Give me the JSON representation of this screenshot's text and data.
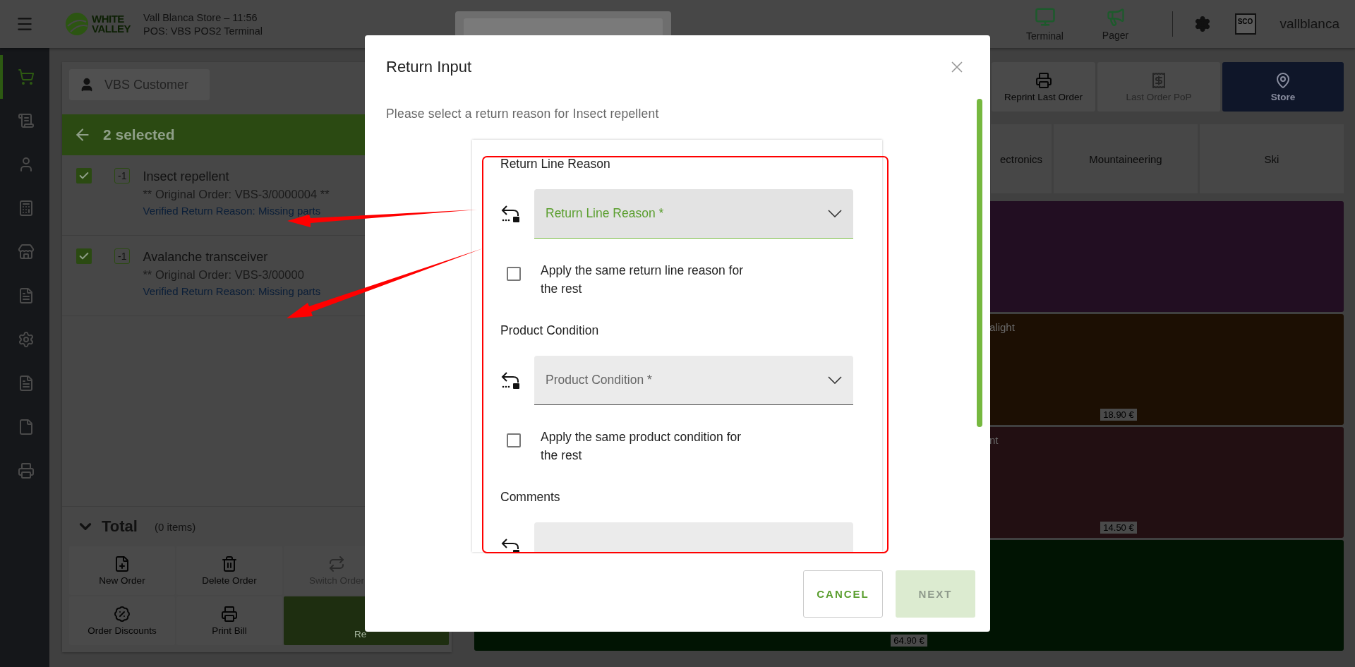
{
  "header": {
    "logo": [
      "WHITE",
      "VALLEY"
    ],
    "store_line": "Vall Blanca Store – 11:56",
    "terminal_line": "POS: VBS POS2 Terminal",
    "shortcuts": [
      {
        "label": "Terminal"
      },
      {
        "label": "Pager"
      }
    ],
    "sco_label": "SCO",
    "username": "vallblanca"
  },
  "sidebar": {
    "items": [
      {
        "selected": true
      },
      {
        "selected": false
      },
      {
        "selected": false
      },
      {
        "selected": false
      },
      {
        "selected": false
      },
      {
        "selected": false
      },
      {
        "selected": false
      },
      {
        "selected": false
      },
      {
        "selected": false
      },
      {
        "selected": false
      }
    ]
  },
  "ticket": {
    "customer": "VBS Customer",
    "selection_count": "2 selected",
    "lines": [
      {
        "checked": true,
        "quantity": "-1",
        "name": "Insect repellent",
        "original_order": "** Original Order: VBS-3/0000004 **",
        "return_reason": "Verified Return Reason: Missing parts"
      },
      {
        "checked": true,
        "quantity": "-1",
        "name": "Avalanche transceiver",
        "original_order": "** Original Order: VBS-3/00000",
        "return_reason": "Verified Return Reason: Missing parts"
      }
    ],
    "total_label": "Total",
    "total_items": "(0 items)",
    "actions": [
      {
        "label": "New Order",
        "kind": "normal"
      },
      {
        "label": "Delete Order",
        "kind": "normal"
      },
      {
        "label": "Switch Order",
        "kind": "disabled"
      },
      {
        "label": "Order Discounts",
        "kind": "normal"
      },
      {
        "label": "Print Bill",
        "kind": "normal"
      },
      {
        "label": "Re",
        "kind": "primary"
      }
    ]
  },
  "toolbar": [
    {
      "label": "Reprint Last Order",
      "kind": "normal"
    },
    {
      "label": "Last Order PoP",
      "kind": "disabled"
    },
    {
      "label": "Store",
      "kind": "primary"
    }
  ],
  "categories": [
    {
      "label": "ectronics"
    },
    {
      "label": "Mountaineering"
    },
    {
      "label": "Ski"
    }
  ],
  "products": [
    {
      "color": "#220e22"
    },
    {
      "name": "alight",
      "price": "18.90 €",
      "color": "#1c0f03"
    },
    {
      "name": "nt",
      "price": "14.50 €",
      "color": "#220f12"
    },
    {
      "price": "64.90 €",
      "color": "#011403"
    }
  ],
  "dialog": {
    "title": "Return Input",
    "message": "Please select a return reason for Insect repellent",
    "sections": [
      {
        "kind": "select",
        "heading": "Return Line Reason",
        "placeholder": "Return Line Reason *",
        "focused": true,
        "apply_all": {
          "label": "Apply the same return line reason for the rest",
          "checked": false
        }
      },
      {
        "kind": "select",
        "heading": "Product Condition",
        "placeholder": "Product Condition *",
        "focused": false,
        "apply_all": {
          "label": "Apply the same product condition for the rest",
          "checked": false
        }
      },
      {
        "kind": "text",
        "heading": "Comments"
      }
    ],
    "buttons": [
      {
        "label": "CANCEL",
        "kind": "outline",
        "disabled": false
      },
      {
        "label": "NEXT",
        "kind": "filled",
        "disabled": true
      }
    ]
  }
}
